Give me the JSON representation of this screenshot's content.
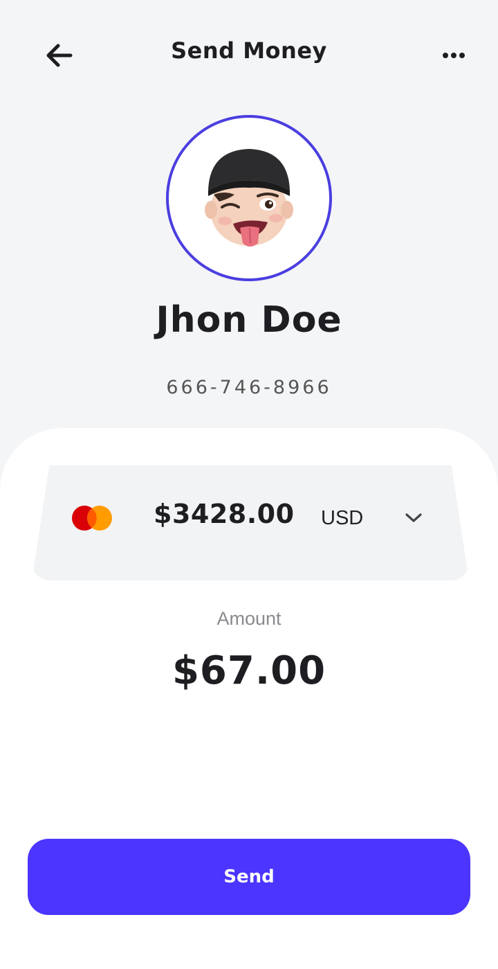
{
  "header": {
    "title": "Send Money",
    "back_icon": "arrow-left-icon",
    "more_icon": "more-horizontal-icon"
  },
  "contact": {
    "name": "Jhon Doe",
    "phone": "666-746-8966",
    "avatar": "memoji-avatar"
  },
  "card": {
    "brand_icon": "mastercard-icon",
    "balance": "$3428.00",
    "currency": "USD",
    "dropdown_icon": "chevron-down-icon"
  },
  "amount": {
    "label": "Amount",
    "value": "$67.00"
  },
  "actions": {
    "send_label": "Send"
  },
  "colors": {
    "accent": "#4b35ff",
    "avatar_ring": "#4a3ee0",
    "background": "#f4f5f7",
    "sheet": "#ffffff"
  }
}
